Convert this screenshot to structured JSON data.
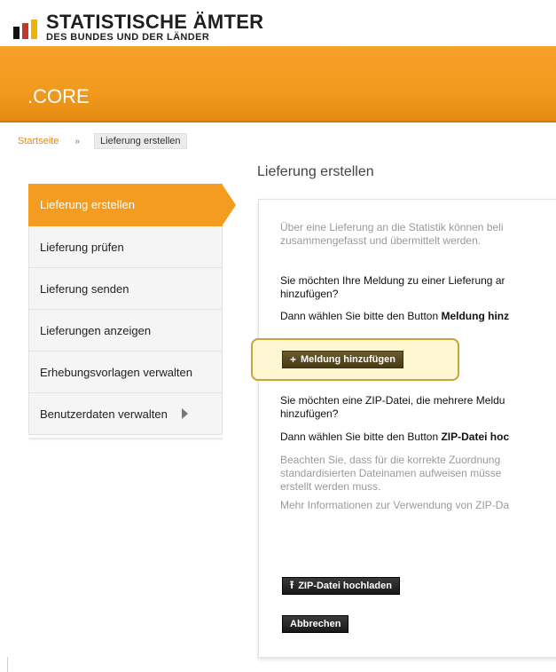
{
  "header": {
    "logo_title": "STATISTISCHE ÄMTER",
    "logo_subtitle": "DES BUNDES UND DER LÄNDER",
    "app_name": ".CORE"
  },
  "breadcrumb": {
    "home": "Startseite",
    "separator": "»",
    "current": "Lieferung erstellen"
  },
  "page_title": "Lieferung erstellen",
  "sidebar": {
    "items": [
      {
        "label": "Lieferung erstellen",
        "active": true
      },
      {
        "label": "Lieferung prüfen"
      },
      {
        "label": "Lieferung senden"
      },
      {
        "label": "Lieferungen anzeigen"
      },
      {
        "label": "Erhebungsvorlagen verwalten"
      },
      {
        "label": "Benutzerdaten verwalten"
      }
    ]
  },
  "content": {
    "intro_line1": "Über eine Lieferung an die Statistik können beli",
    "intro_line2": "zusammengefasst und übermittelt werden.",
    "q1_line1": "Sie möchten Ihre Meldung zu einer Lieferung ar",
    "q1_line2": "hinzufügen?",
    "q1_hint_prefix": "Dann wählen Sie bitte den Button ",
    "q1_hint_bold": "Meldung hinz",
    "add_button": "Meldung hinzufügen",
    "q2_line1": "Sie möchten eine ZIP-Datei, die mehrere Meldu",
    "q2_line2": "hinzufügen?",
    "q2_hint_prefix": "Dann wählen Sie bitte den Button ",
    "q2_hint_bold": "ZIP-Datei hoc",
    "note_line1": "Beachten Sie, dass für die korrekte Zuordnung",
    "note_line2": "standardisierten Dateinamen aufweisen müsse",
    "note_line3": "erstellt werden muss.",
    "more_info": "Mehr Informationen zur Verwendung von ZIP-Da",
    "upload_button": "ZIP-Datei hochladen",
    "cancel_button": "Abbrechen"
  },
  "icons": {
    "add": "plus-icon",
    "upload": "upload-icon",
    "submenu": "chevron-right-icon"
  },
  "colors": {
    "accent": "#f39c1f",
    "link": "#e08a12",
    "highlight_border": "#c9a437"
  }
}
